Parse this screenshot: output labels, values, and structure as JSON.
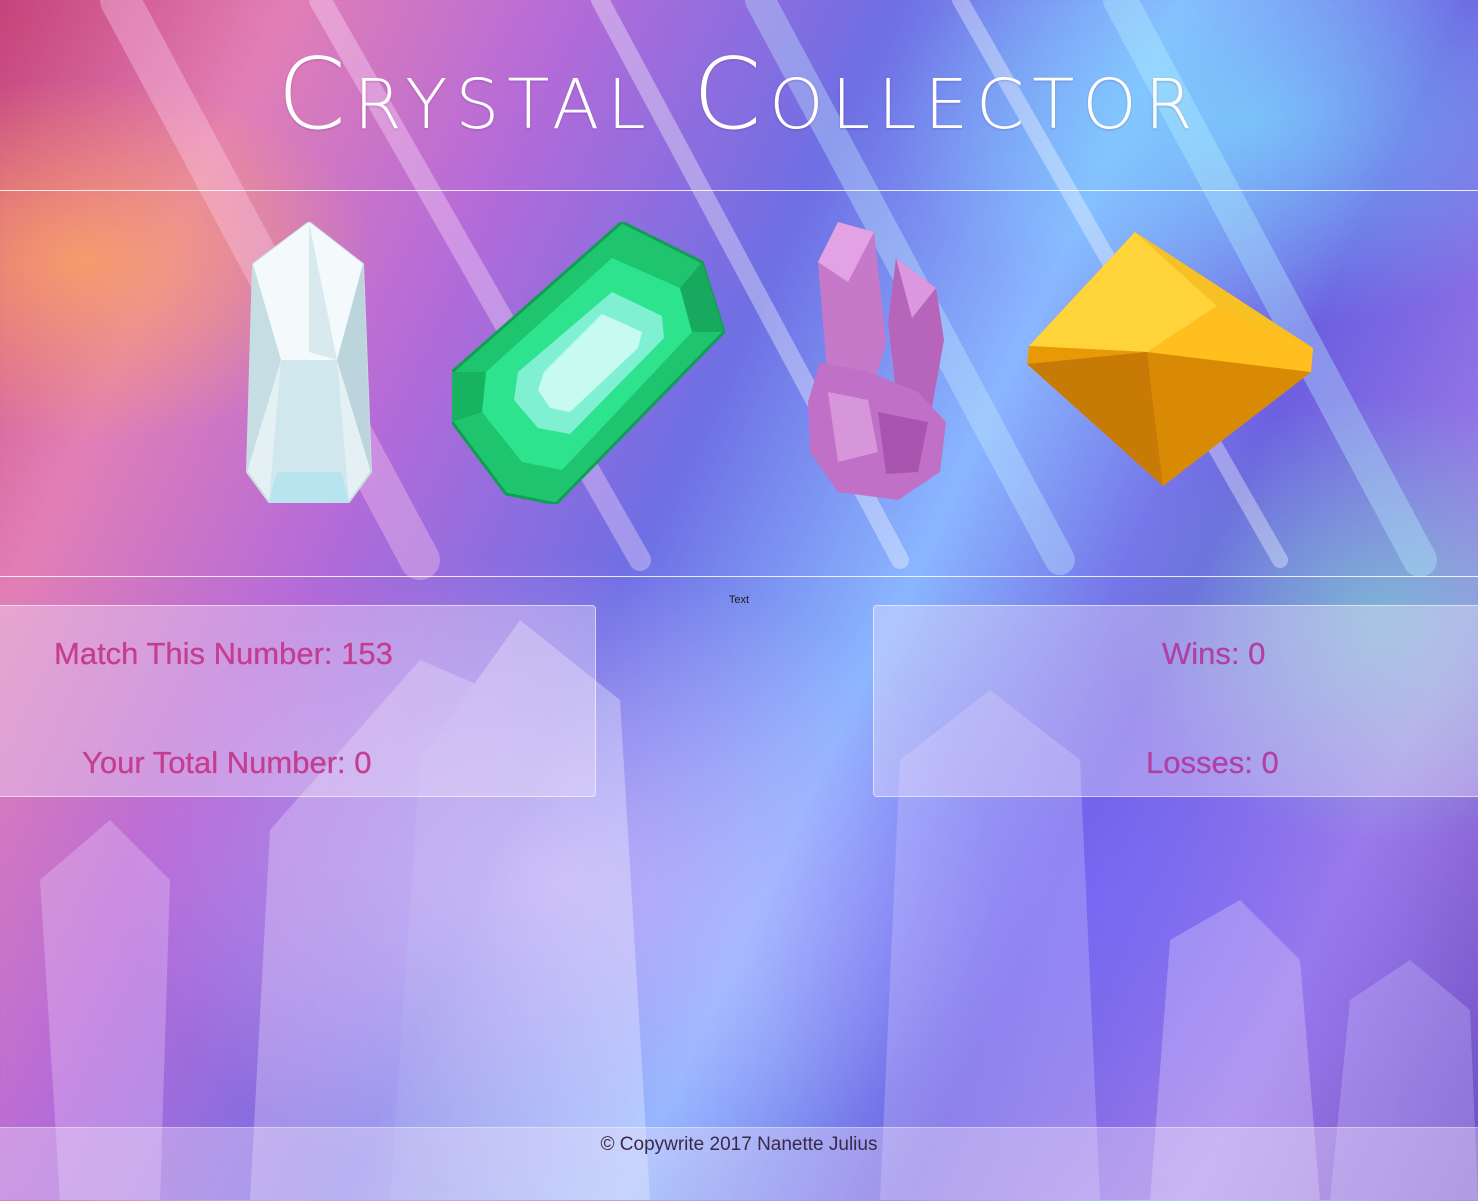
{
  "app": {
    "title": "Crystal Collector",
    "hint_text": "Text"
  },
  "crystals": [
    {
      "name": "clear quartz crystal",
      "color": "#dfeff3"
    },
    {
      "name": "green emerald crystal",
      "color": "#19d27a"
    },
    {
      "name": "pink amethyst crystal",
      "color": "#c77ac9"
    },
    {
      "name": "yellow topaz crystal",
      "color": "#f3b21c"
    }
  ],
  "scoreboard": {
    "target_label": "Match This Number: 153",
    "total_label": "Your Total Number: 0",
    "wins_label": "Wins: 0",
    "losses_label": "Losses: 0"
  },
  "footer": {
    "text": "© Copywrite 2017 Nanette Julius"
  },
  "colors": {
    "stat_pink": "#c53d8f",
    "stat_purple": "#b23fa3",
    "title": "#ffffff"
  }
}
